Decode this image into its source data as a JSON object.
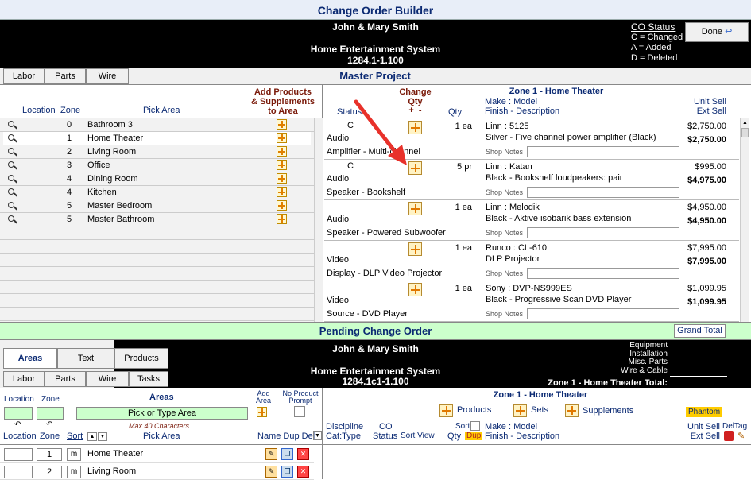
{
  "title": "Change Order Builder",
  "client": {
    "name": "John & Mary Smith",
    "system": "Home Entertainment System",
    "number": "1284.1-1.100"
  },
  "co_status": {
    "heading": "CO Status",
    "lines": [
      "C = Changed",
      "A = Added",
      "D = Deleted"
    ]
  },
  "done_label": "Done",
  "top_tabs": [
    "Labor",
    "Parts",
    "Wire"
  ],
  "master_project": "Master Project",
  "add_products_label": [
    "Add Products",
    "& Supplements",
    "to Area"
  ],
  "areas_headers": {
    "location": "Location",
    "zone": "Zone",
    "pick_area": "Pick Area"
  },
  "areas": [
    {
      "zone": "0",
      "name": "Bathroom 3"
    },
    {
      "zone": "1",
      "name": "Home Theater"
    },
    {
      "zone": "2",
      "name": "Living Room"
    },
    {
      "zone": "3",
      "name": "Office"
    },
    {
      "zone": "4",
      "name": "Dining Room"
    },
    {
      "zone": "4",
      "name": "Kitchen"
    },
    {
      "zone": "5",
      "name": "Master Bedroom"
    },
    {
      "zone": "5",
      "name": "Master Bathroom"
    }
  ],
  "products_headers": {
    "status": "Status",
    "change": "Change",
    "qty_label": "Qty",
    "plusminus": "+  -",
    "qty": "Qty",
    "zone": "Zone 1 - Home Theater",
    "make_model": "Make : Model",
    "finish": "Finish - Description",
    "unit_sell": "Unit Sell",
    "ext_sell": "Ext Sell"
  },
  "shop_notes": "Shop Notes",
  "products": [
    {
      "status": "C",
      "category": "Audio",
      "type": "Amplifier - Multi-channel",
      "qty": "1 ea",
      "model": "Linn : 5125",
      "desc": "Silver - Five channel power amplifier (Black)",
      "unit": "$2,750.00",
      "ext": "$2,750.00"
    },
    {
      "status": "C",
      "category": "Audio",
      "type": "Speaker - Bookshelf",
      "qty": "5 pr",
      "model": "Linn : Katan",
      "desc": "Black - Bookshelf loudpeakers: pair",
      "unit": "$995.00",
      "ext": "$4,975.00"
    },
    {
      "status": "",
      "category": "Audio",
      "type": "Speaker - Powered Subwoofer",
      "qty": "1 ea",
      "model": "Linn : Melodik",
      "desc": "Black - Aktive isobarik bass extension",
      "unit": "$4,950.00",
      "ext": "$4,950.00"
    },
    {
      "status": "",
      "category": "Video",
      "type": "Display - DLP Video Projector",
      "qty": "1 ea",
      "model": "Runco : CL-610",
      "desc": "DLP Projector",
      "unit": "$7,995.00",
      "ext": "$7,995.00"
    },
    {
      "status": "",
      "category": "Video",
      "type": "Source - DVD Player",
      "qty": "1 ea",
      "model": "Sony : DVP-NS999ES",
      "desc": "Black - Progressive Scan DVD Player",
      "unit": "$1,099.95",
      "ext": "$1,099.95"
    }
  ],
  "pending": {
    "title": "Pending Change Order",
    "grand_total": "Grand Total",
    "number": "1284.1c1-1.100",
    "summary": [
      "Equipment",
      "Installation",
      "Misc. Parts",
      "Wire & Cable"
    ],
    "zone_total": "Zone 1 - Home Theater Total:"
  },
  "bottom_tabs_row1": [
    "Areas",
    "Text",
    "Products"
  ],
  "bottom_tabs_row2": [
    "Labor",
    "Parts",
    "Wire",
    "Tasks"
  ],
  "area_form": {
    "location": "Location",
    "zone": "Zone",
    "areas": "Areas",
    "add_area": [
      "Add",
      "Area"
    ],
    "no_product": [
      "No Product",
      "Prompt"
    ],
    "placeholder": "Pick or Type Area",
    "max": "Max 40 Characters",
    "col_location": "Location",
    "col_zone": "Zone",
    "sort": "Sort",
    "pick_area": "Pick Area",
    "name_dup_del": "Name Dup Del",
    "m": "m"
  },
  "pending_areas": [
    {
      "zone": "1",
      "name": "Home Theater"
    },
    {
      "zone": "2",
      "name": "Living Room"
    }
  ],
  "pending_products": {
    "zone": "Zone 1 - Home Theater",
    "products": "Products",
    "sets": "Sets",
    "supplements": "Supplements",
    "phantom": "Phantom",
    "discipline": "Discipline",
    "cat_type": "Cat:Type",
    "co": "CO",
    "status": "Status",
    "sort": "Sort",
    "view": "View",
    "sort2": "Sort",
    "qty": "Qty",
    "dup": "Dup",
    "make_model": "Make : Model",
    "finish": "Finish - Description",
    "unit_sell": "Unit Sell",
    "ext_sell": "Ext Sell",
    "deltag": "DelTag"
  },
  "colors": {
    "navy": "#0b2a73",
    "maroon": "#7a1a0a",
    "green": "#ccffcc",
    "header_bg": "#000000"
  }
}
